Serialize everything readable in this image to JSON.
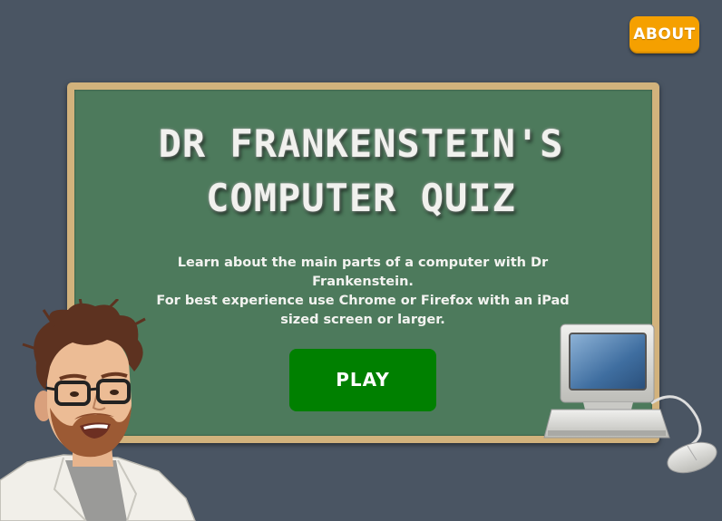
{
  "about_label": "ABOUT",
  "title_line1": "DR FRANKENSTEIN'S",
  "title_line2": "COMPUTER QUIZ",
  "description": "Learn about the main parts of a computer with Dr Frankenstein.",
  "note": "For best experience use Chrome or Firefox with an iPad sized screen or larger.",
  "play_label": "PLAY",
  "colors": {
    "background": "#4a5563",
    "board": "#4d7a5c",
    "board_frame": "#d2b27c",
    "about_button": "#f5a000",
    "play_button": "#008000"
  },
  "images": [
    "dr-frankenstein-character",
    "desktop-computer-illustration"
  ]
}
